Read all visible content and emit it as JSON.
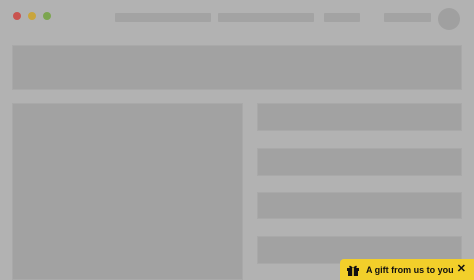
{
  "window": {
    "controls": [
      "close-dot",
      "minimize-dot",
      "maximize-dot"
    ]
  },
  "gift_banner": {
    "text": "A gift from us to you",
    "icon": "gift-icon",
    "close_symbol": "✕",
    "background": "#f2cf2a"
  }
}
